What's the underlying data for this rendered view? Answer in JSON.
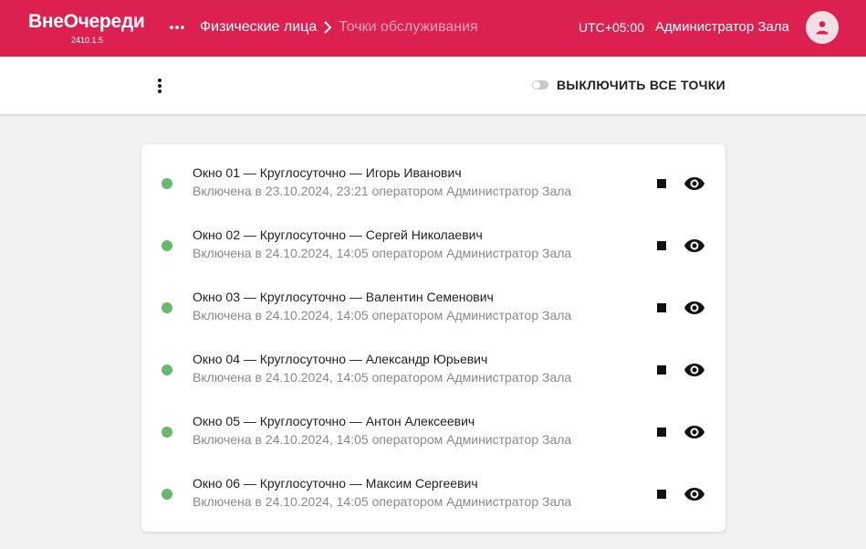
{
  "app": {
    "name": "ВнеОчереди",
    "version": "2410.1.5"
  },
  "header": {
    "menu_icon": "more-horiz-icon",
    "breadcrumb": [
      "Физические лица",
      "Точки обслуживания"
    ],
    "timezone": "UTC+05:00",
    "user": "Администратор Зала",
    "avatar_icon": "person-icon"
  },
  "toolbar": {
    "more_icon": "more-vert-icon",
    "toggle_label": "ВЫКЛЮЧИТЬ ВСЕ ТОЧКИ",
    "toggle_on": false
  },
  "points": [
    {
      "title": "Окно 01 — Круглосуточно — Игорь Иванович",
      "status": "Включена в 23.10.2024, 23:21 оператором Администратор Зала"
    },
    {
      "title": "Окно 02 — Круглосуточно — Сергей Николаевич",
      "status": "Включена в 24.10.2024, 14:05 оператором Администратор Зала"
    },
    {
      "title": "Окно 03 — Круглосуточно — Валентин Семенович",
      "status": "Включена в 24.10.2024, 14:05 оператором Администратор Зала"
    },
    {
      "title": "Окно 04 — Круглосуточно — Александр Юрьевич",
      "status": "Включена в 24.10.2024, 14:05 оператором Администратор Зала"
    },
    {
      "title": "Окно 05 — Круглосуточно — Антон Алексеевич",
      "status": "Включена в 24.10.2024, 14:05 оператором Администратор Зала"
    },
    {
      "title": "Окно 06 — Круглосуточно — Максим Сергеевич",
      "status": "Включена в 24.10.2024, 14:05 оператором Администратор Зала"
    }
  ],
  "colors": {
    "brand": "#dc2150",
    "active": "#66bb6a",
    "muted": "#8a8a8a"
  }
}
